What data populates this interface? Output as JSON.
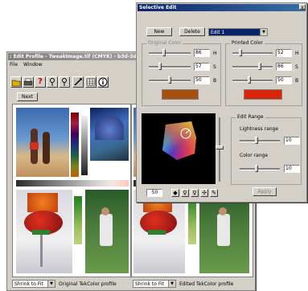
{
  "edit_profile": {
    "title": ": Edit Profile - TweakImage.tif (CMYK) - b3d-3dcm",
    "menu": [
      "File",
      "Window"
    ],
    "next_label": "Next",
    "left_pane": {
      "scale_option": "Shrink to Fit",
      "caption": "Original TekColor profile"
    },
    "right_pane": {
      "scale_option": "Shrink to Fit",
      "caption": "Edited TekColor profile"
    }
  },
  "selective_edit": {
    "title": "Selective Edit",
    "close_label": "x",
    "new_label": "New",
    "delete_label": "Delete",
    "edit_select": "Edit 1",
    "original_color": {
      "label": "Original Color",
      "h": "86",
      "s": "57",
      "b": "50",
      "h_label": "H",
      "s_label": "S",
      "b_label": "B",
      "swatch": "#a4500f"
    },
    "printed_color": {
      "label": "Printed Color",
      "h": "52",
      "s": "86",
      "b": "50",
      "h_label": "H",
      "s_label": "S",
      "b_label": "B",
      "swatch": "#d8240a"
    },
    "gamut_value": "50",
    "edit_range": {
      "label": "Edit Range",
      "lightness_label": "Lightness range",
      "lightness_value": "10",
      "color_label": "Color range",
      "color_value": "10"
    },
    "apply_label": "Apply"
  }
}
